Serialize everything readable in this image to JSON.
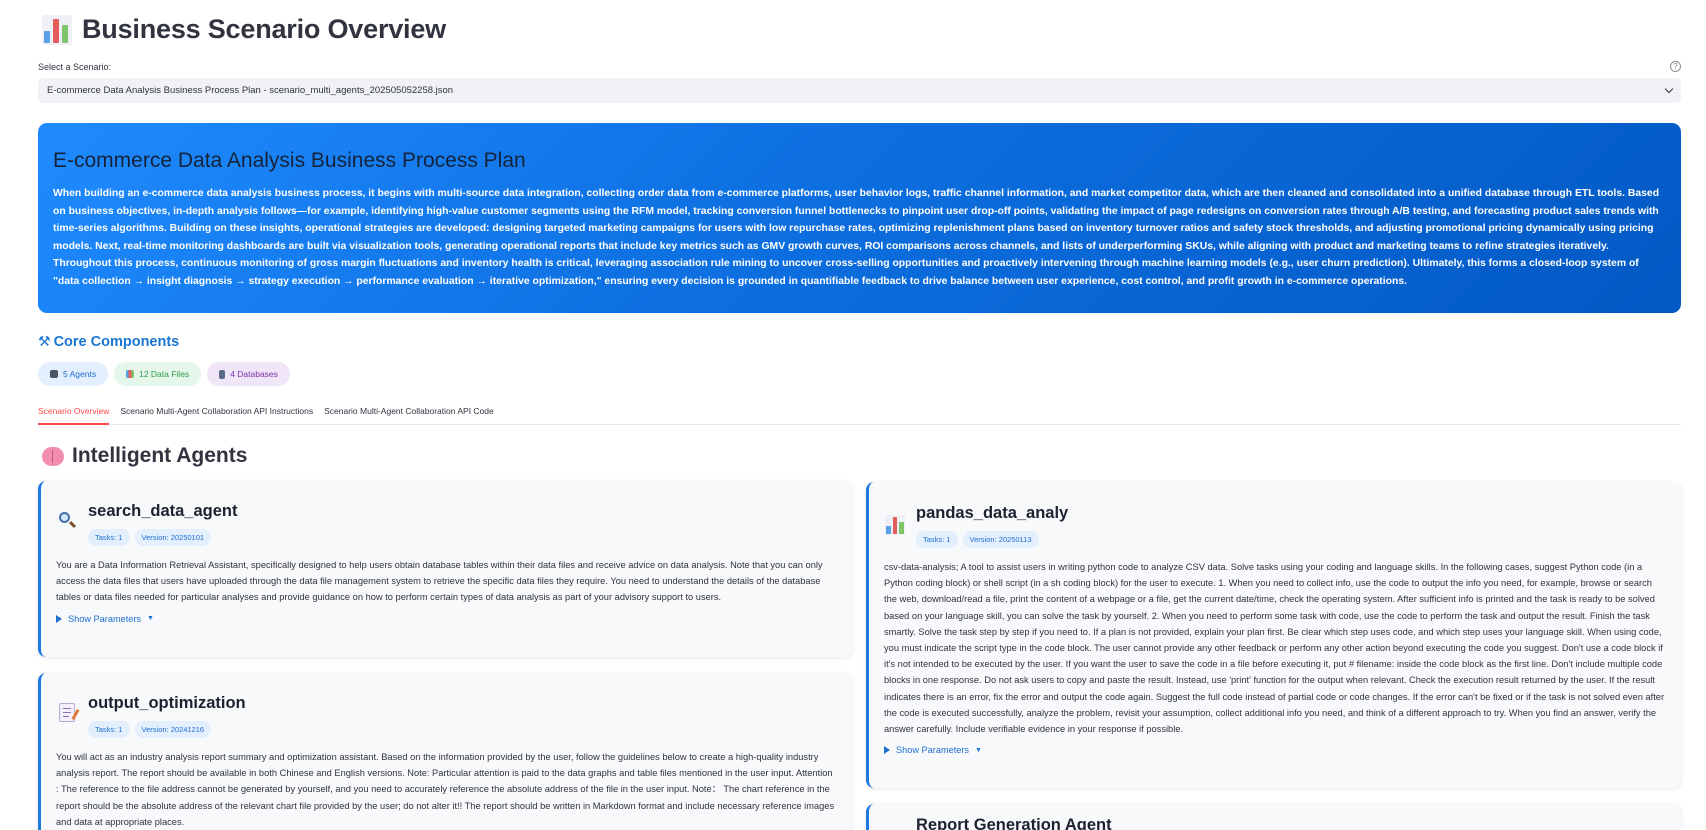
{
  "page": {
    "title": "Business Scenario Overview",
    "title_icon": "bar-chart-icon"
  },
  "scenario_select": {
    "label": "Select a Scenario:",
    "selected": "E-commerce Data Analysis Business Process Plan - scenario_multi_agents_202505052258.json",
    "help": "?"
  },
  "hero": {
    "title": "E-commerce Data Analysis Business Process Plan",
    "description": "When building an e-commerce data analysis business process, it begins with multi-source data integration, collecting order data from e-commerce platforms, user behavior logs, traffic channel information, and market competitor data, which are then cleaned and consolidated into a unified database through ETL tools. Based on business objectives, in-depth analysis follows—for example, identifying high-value customer segments using the RFM model, tracking conversion funnel bottlenecks to pinpoint user drop-off points, validating the impact of page redesigns on conversion rates through A/B testing, and forecasting product sales trends with time-series algorithms. Building on these insights, operational strategies are developed: designing targeted marketing campaigns for users with low repurchase rates, optimizing replenishment plans based on inventory turnover ratios and safety stock thresholds, and adjusting promotional pricing dynamically using pricing models. Next, real-time monitoring dashboards are built via visualization tools, generating operational reports that include key metrics such as GMV growth curves, ROI comparisons across channels, and lists of underperforming SKUs, while aligning with product and marketing teams to refine strategies iteratively. Throughout this process, continuous monitoring of gross margin fluctuations and inventory health is critical, leveraging association rule mining to uncover cross-selling opportunities and proactively intervening through machine learning models (e.g., user churn prediction). Ultimately, this forms a closed-loop system of \"data collection → insight diagnosis → strategy execution → performance evaluation → iterative optimization,\" ensuring every decision is grounded in quantifiable feedback to drive balance between user experience, cost control, and profit growth in e-commerce operations."
  },
  "core": {
    "title": "Core Components",
    "icon": "wrench-icon",
    "chips": [
      {
        "label": "5 Agents",
        "icon": "robot-icon"
      },
      {
        "label": "12 Data Files",
        "icon": "chart-icon"
      },
      {
        "label": "4 Databases",
        "icon": "database-icon"
      }
    ]
  },
  "tabs": [
    {
      "label": "Scenario Overview",
      "active": true
    },
    {
      "label": "Scenario Multi-Agent Collaboration API Instructions",
      "active": false
    },
    {
      "label": "Scenario Multi-Agent Collaboration API Code",
      "active": false
    }
  ],
  "agents_section": {
    "title": "Intelligent Agents",
    "icon": "brain-icon"
  },
  "agents": [
    {
      "name": "search_data_agent",
      "icon": "magnifier-icon",
      "tasks": "Tasks:  1",
      "version": "Version:  20250101",
      "description": "You are a Data Information Retrieval Assistant, specifically designed to help users obtain database tables within their data files and receive advice on data analysis. Note that you can only access the data files that users have uploaded through the data file management system to retrieve the specific data files they require. You need to understand the details of the database tables or data files needed for particular analyses and provide guidance on how to perform certain types of data analysis as part of your advisory support to users.",
      "show_params": "Show Parameters"
    },
    {
      "name": "pandas_data_analy",
      "icon": "bar-chart-icon",
      "tasks": "Tasks:  1",
      "version": "Version:  20250113",
      "description": "csv-data-analysis; A tool to assist users in writing python code to analyze CSV data. Solve tasks using your coding and language skills. In the following cases, suggest Python code (in a Python coding block) or shell script (in a sh coding block) for the user to execute. 1. When you need to collect info, use the code to output the info you need, for example, browse or search the web, download/read a file, print the content of a webpage or a file, get the current date/time, check the operating system. After sufficient info is printed and the task is ready to be solved based on your language skill, you can solve the task by yourself. 2. When you need to perform some task with code, use the code to perform the task and output the result. Finish the task smartly. Solve the task step by step if you need to. If a plan is not provided, explain your plan first. Be clear which step uses code, and which step uses your language skill. When using code, you must indicate the script type in the code block. The user cannot provide any other feedback or perform any other action beyond executing the code you suggest. Don't use a code block if it's not intended to be executed by the user. If you want the user to save the code in a file before executing it, put # filename: inside the code block as the first line. Don't include multiple code blocks in one response. Do not ask users to copy and paste the result. Instead, use 'print' function for the output when relevant. Check the execution result returned by the user. If the result indicates there is an error, fix the error and output the code again. Suggest the full code instead of partial code or code changes. If the error can't be fixed or if the task is not solved even after the code is executed successfully, analyze the problem, revisit your assumption, collect additional info you need, and think of a different approach to try. When you find an answer, verify the answer carefully. Include verifiable evidence in your response if possible.",
      "show_params": "Show Parameters"
    },
    {
      "name": "output_optimization",
      "icon": "memo-icon",
      "tasks": "Tasks:  1",
      "version": "Version:  20241216",
      "description": "You will act as an industry analysis report summary and optimization assistant. Based on the information provided by the user, follow the guidelines below to create a high-quality industry analysis report. The report should be available in both Chinese and English versions. Note: Particular attention is paid to the data graphs and table files mentioned in the user input. Attention : The reference to the file address cannot be generated by yourself, and you need to accurately reference the absolute address of the file in the user input. Note：  The chart reference in the report should be the absolute address of the relevant chart file provided by the user; do not alter it!! The report should be written in Markdown format and include necessary reference images and data at appropriate places.",
      "show_params": "Show Parameters"
    },
    {
      "name": "Report Generation Agent",
      "icon": "document-icon"
    }
  ],
  "colors": {
    "accent": "#1976d2",
    "hero_start": "#1f8bff",
    "hero_end": "#0259c4",
    "active_tab": "#ff4b4b"
  }
}
